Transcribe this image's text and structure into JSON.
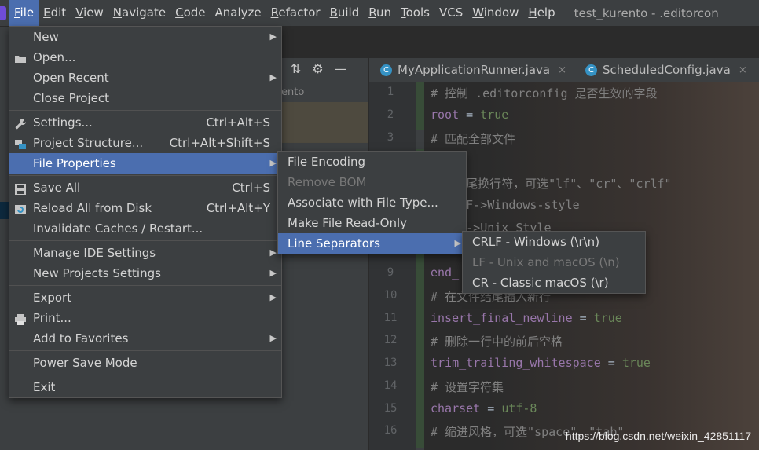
{
  "menubar": {
    "items": [
      {
        "label": "File",
        "u": "F",
        "rest": "ile"
      },
      {
        "label": "Edit",
        "u": "E",
        "rest": "dit"
      },
      {
        "label": "View",
        "u": "V",
        "rest": "iew"
      },
      {
        "label": "Navigate",
        "u": "N",
        "rest": "avigate"
      },
      {
        "label": "Code",
        "u": "C",
        "rest": "ode"
      },
      {
        "label": "Analyze",
        "u": "",
        "rest": "Analyze"
      },
      {
        "label": "Refactor",
        "u": "R",
        "rest": "efactor"
      },
      {
        "label": "Build",
        "u": "B",
        "rest": "uild"
      },
      {
        "label": "Run",
        "u": "R",
        "rest": "un"
      },
      {
        "label": "Tools",
        "u": "T",
        "rest": "ools"
      },
      {
        "label": "VCS",
        "u": "",
        "rest": "VCS"
      },
      {
        "label": "Window",
        "u": "W",
        "rest": "indow"
      },
      {
        "label": "Help",
        "u": "H",
        "rest": "elp"
      }
    ],
    "title": "test_kurento - .editorcon"
  },
  "project_panel": {
    "fragment": "ento",
    "tools": [
      "⇅",
      "⚙",
      "—"
    ]
  },
  "tabs": [
    {
      "label": "MyApplicationRunner.java",
      "close": "×"
    },
    {
      "label": "ScheduledConfig.java",
      "close": "×"
    }
  ],
  "editor": {
    "lines": [
      {
        "n": "1",
        "segs": [
          {
            "t": "# 控制 .editorconfig 是否生效的字段",
            "c": "c-comment"
          }
        ]
      },
      {
        "n": "2",
        "segs": [
          {
            "t": "root",
            "c": "c-key"
          },
          {
            "t": " = ",
            "c": "c-op"
          },
          {
            "t": "true",
            "c": "c-val"
          }
        ]
      },
      {
        "n": "3",
        "segs": [
          {
            "t": "# 匹配全部文件",
            "c": "c-comment"
          }
        ]
      },
      {
        "n": "",
        "segs": [
          {
            "t": "",
            "c": "c-comment"
          }
        ]
      },
      {
        "n": "",
        "segs": [
          {
            "t": "     尾换行符，可选\"lf\"、\"cr\"、\"crlf\"",
            "c": "c-comment"
          }
        ]
      },
      {
        "n": "",
        "segs": [
          {
            "t": "    LF->Windows-style",
            "c": "c-comment"
          }
        ]
      },
      {
        "n": "",
        "segs": [
          {
            "t": "     ->Unix Style",
            "c": "c-comment"
          }
        ]
      },
      {
        "n": "",
        "segs": [
          {
            "t": "",
            "c": "c-comment"
          }
        ]
      },
      {
        "n": "9",
        "segs": [
          {
            "t": "end_",
            "c": "c-key"
          }
        ]
      },
      {
        "n": "10",
        "segs": [
          {
            "t": "# 在文件结尾插入新行",
            "c": "c-comment"
          }
        ]
      },
      {
        "n": "11",
        "segs": [
          {
            "t": "insert_final_newline",
            "c": "c-key"
          },
          {
            "t": " = ",
            "c": "c-op"
          },
          {
            "t": "true",
            "c": "c-val"
          }
        ]
      },
      {
        "n": "12",
        "segs": [
          {
            "t": "# 删除一行中的前后空格",
            "c": "c-comment"
          }
        ]
      },
      {
        "n": "13",
        "segs": [
          {
            "t": "trim_trailing_whitespace",
            "c": "c-key"
          },
          {
            "t": " = ",
            "c": "c-op"
          },
          {
            "t": "true",
            "c": "c-val"
          }
        ]
      },
      {
        "n": "14",
        "segs": [
          {
            "t": "# 设置字符集",
            "c": "c-comment"
          }
        ]
      },
      {
        "n": "15",
        "segs": [
          {
            "t": "charset",
            "c": "c-key"
          },
          {
            "t": " = ",
            "c": "c-op"
          },
          {
            "t": "utf-8",
            "c": "c-val"
          }
        ]
      },
      {
        "n": "16",
        "segs": [
          {
            "t": "# 缩进风格，可选\"space\"、\"tab\"",
            "c": "c-comment"
          }
        ]
      }
    ]
  },
  "file_menu": {
    "items": [
      {
        "type": "item",
        "label": "New",
        "arrow": true,
        "name": "menu-item-new"
      },
      {
        "type": "item",
        "label": "Open...",
        "icon": "folder-icon",
        "name": "menu-item-open"
      },
      {
        "type": "item",
        "label": "Open Recent",
        "arrow": true,
        "name": "menu-item-open-recent"
      },
      {
        "type": "item",
        "label": "Close Project",
        "name": "menu-item-close-project"
      },
      {
        "type": "sep"
      },
      {
        "type": "item",
        "label": "Settings...",
        "shortcut": "Ctrl+Alt+S",
        "icon": "wrench-icon",
        "name": "menu-item-settings"
      },
      {
        "type": "item",
        "label": "Project Structure...",
        "shortcut": "Ctrl+Alt+Shift+S",
        "icon": "project-structure-icon",
        "name": "menu-item-project-structure"
      },
      {
        "type": "item",
        "label": "File Properties",
        "arrow": true,
        "selected": true,
        "name": "menu-item-file-properties"
      },
      {
        "type": "sep"
      },
      {
        "type": "item",
        "label": "Save All",
        "shortcut": "Ctrl+S",
        "icon": "save-icon",
        "name": "menu-item-save-all"
      },
      {
        "type": "item",
        "label": "Reload All from Disk",
        "shortcut": "Ctrl+Alt+Y",
        "icon": "reload-icon",
        "name": "menu-item-reload"
      },
      {
        "type": "item",
        "label": "Invalidate Caches / Restart...",
        "name": "menu-item-invalidate-caches"
      },
      {
        "type": "sep"
      },
      {
        "type": "item",
        "label": "Manage IDE Settings",
        "arrow": true,
        "name": "menu-item-manage-ide-settings"
      },
      {
        "type": "item",
        "label": "New Projects Settings",
        "arrow": true,
        "name": "menu-item-new-projects-settings"
      },
      {
        "type": "sep"
      },
      {
        "type": "item",
        "label": "Export",
        "arrow": true,
        "name": "menu-item-export"
      },
      {
        "type": "item",
        "label": "Print...",
        "icon": "print-icon",
        "name": "menu-item-print"
      },
      {
        "type": "item",
        "label": "Add to Favorites",
        "arrow": true,
        "name": "menu-item-add-to-favorites"
      },
      {
        "type": "sep"
      },
      {
        "type": "item",
        "label": "Power Save Mode",
        "name": "menu-item-power-save-mode"
      },
      {
        "type": "sep"
      },
      {
        "type": "item",
        "label": "Exit",
        "name": "menu-item-exit"
      }
    ]
  },
  "file_properties_menu": {
    "items": [
      {
        "label": "File Encoding",
        "name": "menu-item-file-encoding"
      },
      {
        "label": "Remove BOM",
        "disabled": true,
        "name": "menu-item-remove-bom"
      },
      {
        "label": "Associate with File Type...",
        "name": "menu-item-associate-file-type"
      },
      {
        "label": "Make File Read-Only",
        "name": "menu-item-make-read-only"
      },
      {
        "label": "Line Separators",
        "arrow": true,
        "selected": true,
        "name": "menu-item-line-separators"
      }
    ]
  },
  "line_separators_menu": {
    "items": [
      {
        "label": "CRLF - Windows (\\r\\n)",
        "name": "menu-item-crlf"
      },
      {
        "label": "LF - Unix and macOS (\\n)",
        "disabled": true,
        "name": "menu-item-lf"
      },
      {
        "label": "CR - Classic macOS (\\r)",
        "name": "menu-item-cr"
      }
    ]
  },
  "watermark": "https://blog.csdn.net/weixin_42851117"
}
